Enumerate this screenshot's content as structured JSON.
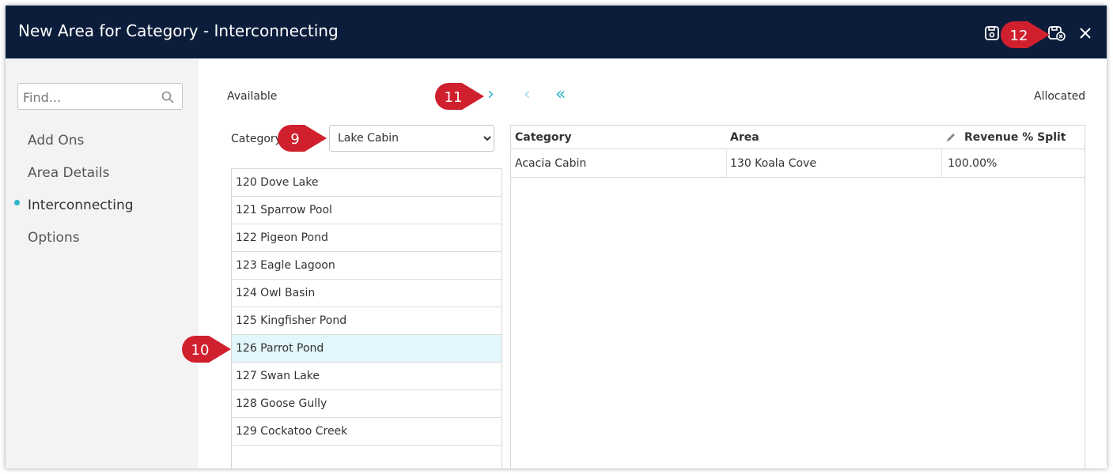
{
  "window": {
    "title": "New Area for Category - Interconnecting"
  },
  "titlebar_icons": [
    "save-icon",
    "save-close-icon",
    "close-icon"
  ],
  "sidebar": {
    "search_placeholder": "Find...",
    "items": [
      {
        "label": "Add Ons",
        "active": false
      },
      {
        "label": "Area Details",
        "active": false
      },
      {
        "label": "Interconnecting",
        "active": true
      },
      {
        "label": "Options",
        "active": false
      }
    ]
  },
  "available": {
    "heading": "Available",
    "category_label": "Category",
    "category_value": "Lake Cabin",
    "items": [
      "120 Dove Lake",
      "121 Sparrow Pool",
      "122 Pigeon Pond",
      "123 Eagle Lagoon",
      "124 Owl Basin",
      "125 Kingfisher Pond",
      "126 Parrot Pond",
      "127 Swan Lake",
      "128 Goose Gully",
      "129 Cockatoo Creek"
    ],
    "selected_item": "126 Parrot Pond"
  },
  "transfer": {
    "move_right": "›",
    "move_left": "‹",
    "move_all_left": "«"
  },
  "allocated": {
    "heading": "Allocated",
    "columns": [
      "Category",
      "Area",
      "Revenue % Split"
    ],
    "rows": [
      {
        "category": "Acacia Cabin",
        "area": "130 Koala Cove",
        "split": "100.00%"
      }
    ]
  },
  "callouts": [
    "9",
    "10",
    "11",
    "12"
  ],
  "colors": {
    "titlebar": "#0b1d3a",
    "accent": "#2bb4cc",
    "callout": "#d0202e",
    "selected_row": "#e2f6fb"
  }
}
